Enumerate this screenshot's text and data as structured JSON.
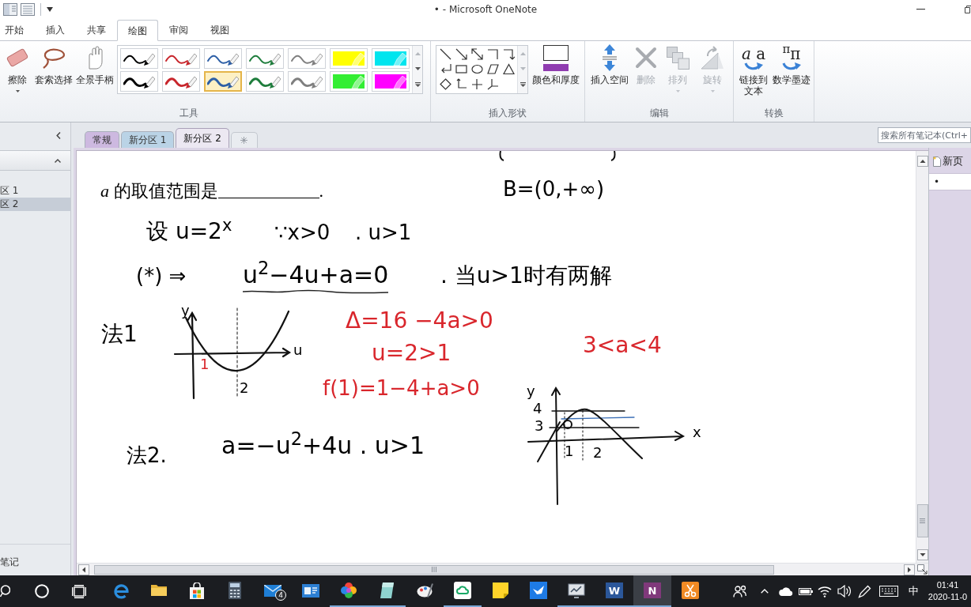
{
  "title_bar": {
    "title": "• - Microsoft OneNote"
  },
  "ribbon_tabs": [
    {
      "label": "开始",
      "selected": false
    },
    {
      "label": "插入",
      "selected": false
    },
    {
      "label": "共享",
      "selected": false
    },
    {
      "label": "绘图",
      "selected": true
    },
    {
      "label": "审阅",
      "selected": false
    },
    {
      "label": "视图",
      "selected": false
    }
  ],
  "ribbon_groups": [
    {
      "kind": "tools",
      "label": "工具",
      "buttons": [
        {
          "label": "擦除",
          "has_menu": true
        },
        {
          "label": "套索选择",
          "has_menu": false
        },
        {
          "label": "全景手柄",
          "has_menu": false
        }
      ],
      "pens": [
        {
          "kind": "thin",
          "color": "#000000",
          "selected": false
        },
        {
          "kind": "thin",
          "color": "#c8262c",
          "selected": false
        },
        {
          "kind": "thin",
          "color": "#2d5fa6",
          "selected": false
        },
        {
          "kind": "thin",
          "color": "#1e7d3c",
          "selected": false
        },
        {
          "kind": "thin",
          "color": "#7f7f7f",
          "selected": false
        },
        {
          "kind": "highlighter",
          "color": "#ffff00",
          "selected": false
        },
        {
          "kind": "highlighter",
          "color": "#00e5ee",
          "selected": false
        },
        {
          "kind": "thick",
          "color": "#000000",
          "selected": false
        },
        {
          "kind": "thick",
          "color": "#c8262c",
          "selected": false
        },
        {
          "kind": "thick",
          "color": "#2d5fa6",
          "selected": true
        },
        {
          "kind": "thick",
          "color": "#1e7d3c",
          "selected": false
        },
        {
          "kind": "thick",
          "color": "#7f7f7f",
          "selected": false
        },
        {
          "kind": "highlighter",
          "color": "#33ee33",
          "selected": false
        },
        {
          "kind": "highlighter",
          "color": "#ff00ff",
          "selected": false
        }
      ]
    },
    {
      "kind": "shapes",
      "label": "插入形状",
      "buttons": [
        {
          "label": "颜色和厚度",
          "has_menu": false
        }
      ]
    },
    {
      "kind": "edit",
      "label": "编辑",
      "buttons": [
        {
          "label": "插入空间",
          "disabled": false,
          "has_menu": false
        },
        {
          "label": "删除",
          "disabled": true,
          "has_menu": false
        },
        {
          "label": "排列",
          "disabled": true,
          "has_menu": true
        },
        {
          "label": "旋转",
          "disabled": true,
          "has_menu": true
        }
      ]
    },
    {
      "kind": "convert",
      "label": "转换",
      "buttons": [
        {
          "label": "链接到文本",
          "glyph": "*a* a"
        },
        {
          "label": "数学墨迹",
          "glyph": "$^{π}$π"
        }
      ]
    }
  ],
  "navigation": {
    "items": [
      {
        "label": "区 1",
        "selected": false
      },
      {
        "label": "区 2",
        "selected": true
      }
    ],
    "footer": "笔记"
  },
  "section_tabs": [
    {
      "label": "常规",
      "color": "#cdb9e0",
      "selected": false
    },
    {
      "label": "新分区 1",
      "color": "#bad3e6",
      "selected": false
    },
    {
      "label": "新分区 2",
      "color": "#ece8f2",
      "selected": true
    }
  ],
  "search": {
    "placeholder": "搜索所有笔记本(Ctrl+"
  },
  "page": {
    "question": {
      "text": "*a* 的取值范围是",
      "end": "."
    },
    "ink": [
      {
        "text": "B=(0,+∞)",
        "color": "#000000",
        "underlined": false
      },
      {
        "text": "设 u=2$^{x}$",
        "color": "#000000",
        "underlined": false
      },
      {
        "text": "∵x>0",
        "color": "#000000",
        "underlined": false
      },
      {
        "text": ". u>1",
        "color": "#000000",
        "underlined": false
      },
      {
        "text": "(*) ⇒",
        "color": "#000000",
        "underlined": false
      },
      {
        "text": "u$^{2}$−4u+a=0",
        "color": "#000000",
        "underlined": true
      },
      {
        "text": ". 当u>1时有两解",
        "color": "#000000",
        "underlined": false
      },
      {
        "text": "Δ=16 −4a>0",
        "color": "#d9262c",
        "underlined": false
      },
      {
        "text": "法1",
        "color": "#000000",
        "underlined": false
      },
      {
        "text": "3<a<4",
        "color": "#d9262c",
        "underlined": false
      },
      {
        "text": "u=2>1",
        "color": "#d9262c",
        "underlined": false
      },
      {
        "text": "f(1)=1−4+a>0",
        "color": "#d9262c",
        "underlined": false
      },
      {
        "text": "a=−u$^{2}$+4u . u>1",
        "color": "#000000",
        "underlined": false
      },
      {
        "text": "法2.",
        "color": "#000000",
        "underlined": false
      }
    ],
    "sketches": [
      {
        "labels": [
          {
            "text": "y",
            "color": "#000000"
          },
          {
            "text": "u",
            "color": "#000000"
          },
          {
            "text": "1",
            "color": "#d9262c"
          },
          {
            "text": "2",
            "color": "#000000"
          }
        ]
      },
      {
        "labels": [
          {
            "text": "y",
            "color": "#000000"
          },
          {
            "text": "4",
            "color": "#000000"
          },
          {
            "text": "3",
            "color": "#000000"
          },
          {
            "text": "x",
            "color": "#000000"
          },
          {
            "text": "1",
            "color": "#000000"
          },
          {
            "text": "2",
            "color": "#000000"
          }
        ]
      }
    ]
  },
  "page_list": {
    "new_page": "新页",
    "pages": [
      {
        "title": "•",
        "selected": true
      }
    ]
  },
  "taskbar": {
    "apps": [
      {
        "selected": false,
        "running": false
      },
      {
        "selected": false,
        "running": false
      },
      {
        "selected": false,
        "running": false
      },
      {
        "selected": false,
        "running": false
      },
      {
        "selected": false,
        "running": false,
        "badge": "4"
      },
      {
        "selected": false,
        "running": false
      },
      {
        "selected": false,
        "running": true
      },
      {
        "selected": false,
        "running": true
      },
      {
        "selected": false,
        "running": false
      },
      {
        "selected": false,
        "running": true
      },
      {
        "selected": false,
        "running": false
      },
      {
        "selected": false,
        "running": false
      },
      {
        "selected": false,
        "running": true
      },
      {
        "selected": false,
        "running": true,
        "logo_text": "W"
      },
      {
        "selected": true,
        "running": true,
        "logo_text": "N"
      },
      {
        "selected": false,
        "running": false
      }
    ],
    "tray": {
      "input_method": "中",
      "time": "01:41",
      "date": "2020-11-0"
    }
  }
}
